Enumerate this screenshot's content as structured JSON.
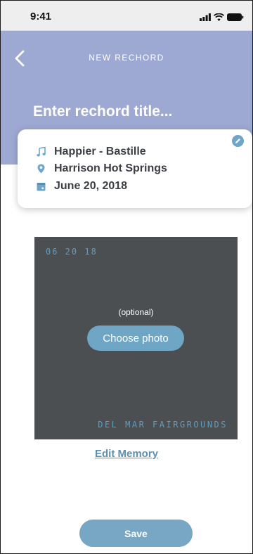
{
  "status_bar": {
    "time": "9:41",
    "icons": [
      "signal-bars-icon",
      "wifi-icon",
      "battery-icon"
    ]
  },
  "header": {
    "back_icon": "chevron-left-icon",
    "title": "NEW RECHORD",
    "title_input_placeholder": "Enter rechord title...",
    "title_input_value": ""
  },
  "info_card": {
    "edit_icon": "pencil-icon",
    "song": "Happier - Bastille",
    "song_icon": "music-note-icon",
    "location": "Harrison Hot Springs",
    "location_icon": "map-pin-icon",
    "date": "June 20, 2018",
    "date_icon": "calendar-icon"
  },
  "photo": {
    "date_stamp": "06 20 18",
    "location_stamp": "DEL MAR FAIRGROUNDS",
    "optional_label": "(optional)",
    "choose_photo_label": "Choose photo"
  },
  "actions": {
    "edit_memory_label": "Edit Memory",
    "save_label": "Save"
  },
  "colors": {
    "header_bg": "#9ea9d3",
    "accent": "#6fa5c8",
    "photo_bg": "#4b4f52",
    "stamp_text": "#5f9cbd",
    "body_text": "#3b3f44"
  }
}
